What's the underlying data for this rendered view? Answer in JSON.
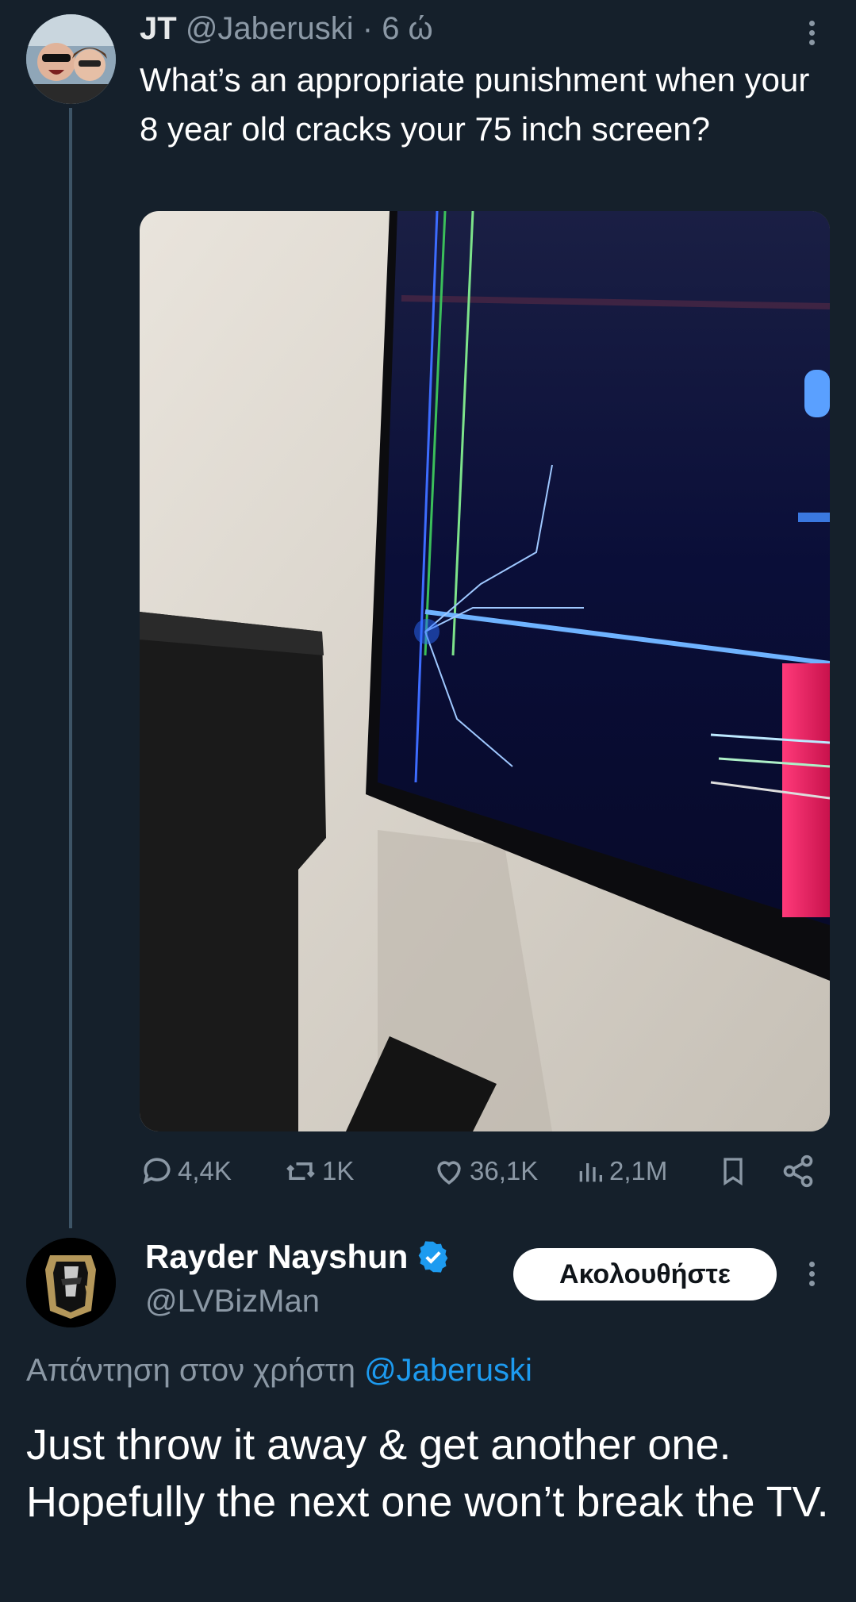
{
  "tweet": {
    "name": "JT",
    "handle": "@Jaberuski",
    "separator": "·",
    "time": "6 ώ",
    "text": "What’s an appropriate punishment when your 8 year old cracks your 75 inch screen?",
    "media_icon": "cracked-tv-photo",
    "stats": {
      "replies": "4,4K",
      "reposts": "1K",
      "likes": "36,1K",
      "views": "2,1M"
    }
  },
  "reply": {
    "name": "Rayder Nayshun",
    "handle": "@LVBizMan",
    "follow_label": "Ακολουθήστε",
    "replying_prefix": "Απάντηση στον χρήστη",
    "replying_to": "@Jaberuski",
    "text": "Just throw it away & get another one. Hopefully the next one won’t break the TV."
  },
  "colors": {
    "background": "#15202b",
    "muted": "#8b98a5",
    "link": "#1d9bf0",
    "verified": "#1d9bf0"
  }
}
